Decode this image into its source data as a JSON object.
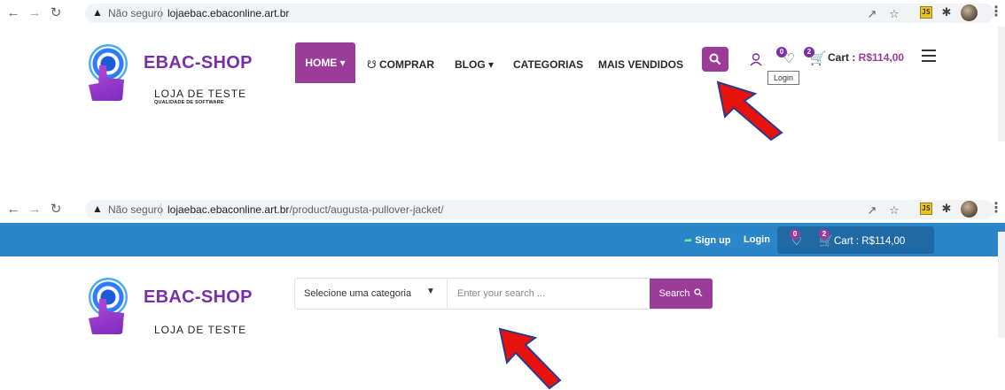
{
  "screenshot1": {
    "browser": {
      "back_icon": "arrow-left-icon",
      "forward_icon": "arrow-right-icon",
      "reload_icon": "reload-icon",
      "security_label": "Não seguro",
      "url_host": "lojaebac.ebaconline.art.br",
      "url_path": ""
    },
    "logo": {
      "name": "EBAC-SHOP",
      "tagline": "LOJA DE TESTE",
      "subtagline": "QUALIDADE DE SOFTWARE"
    },
    "nav": {
      "home": "HOME ▾",
      "comprar": "COMPRAR",
      "blog": "BLOG ▾",
      "categorias": "CATEGORIAS",
      "mais_vendidos": "MAIS VENDIDOS"
    },
    "header": {
      "wishlist_count": "0",
      "cart_count": "2",
      "cart_label": "Cart : ",
      "cart_price": "R$114,00",
      "tooltip": "Login"
    }
  },
  "screenshot2": {
    "browser": {
      "security_label": "Não seguro",
      "url_host": "lojaebac.ebaconline.art.br",
      "url_path": "/product/augusta-pullover-jacket/"
    },
    "topbar": {
      "signup": "Sign up",
      "login": "Login",
      "wishlist_count": "0",
      "cart_count": "2",
      "cart_label": "Cart : R$114,00"
    },
    "logo": {
      "name": "EBAC-SHOP",
      "tagline": "LOJA DE TESTE"
    },
    "search": {
      "category": "Selecione uma categoria",
      "placeholder": "Enter your search ...",
      "button": "Search"
    }
  },
  "colors": {
    "brand_purple": "#9b3c99",
    "topbar_blue": "#2a86c8",
    "arrow_red": "#e8120c",
    "arrow_outline": "#2a3a8c"
  }
}
